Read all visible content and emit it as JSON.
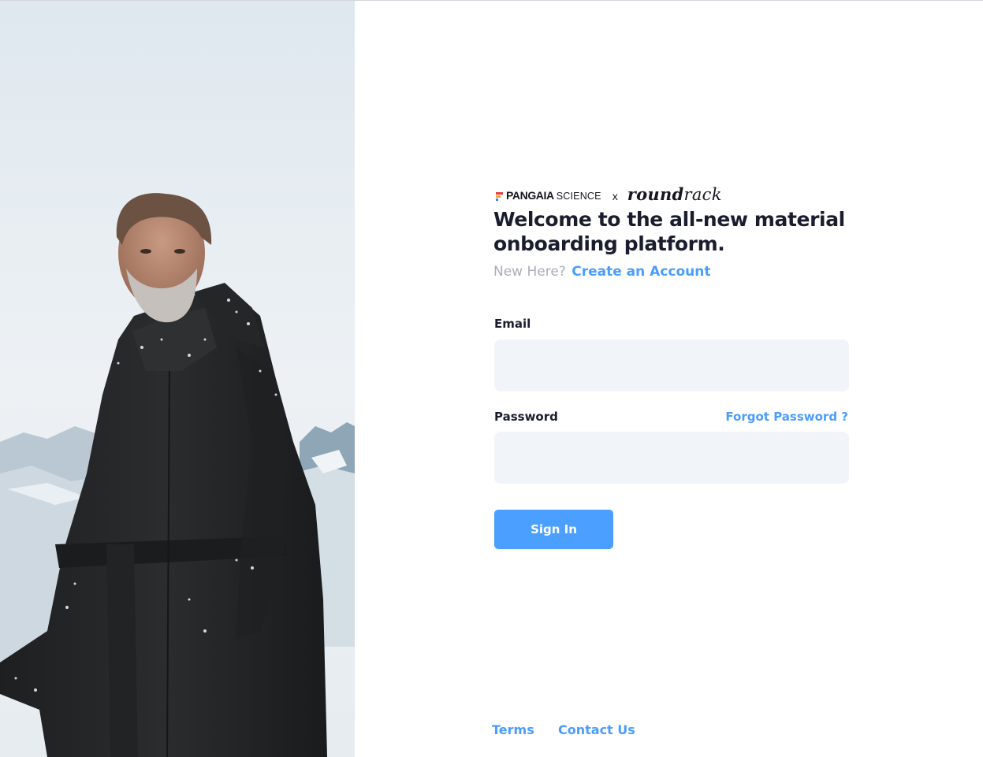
{
  "brand": {
    "partner_name": "PANGAIA",
    "partner_suffix": "SCIENCE",
    "separator": "x",
    "platform_bold": "round",
    "platform_light": "rack",
    "mark_colors": [
      "#e8383d",
      "#f5a623",
      "#3b82f6"
    ]
  },
  "hero": {
    "alt": "Man in a black hooded puffer coat standing in front of snowy mountains"
  },
  "header": {
    "title": "Welcome to the all-new material onboarding platform.",
    "new_here_text": "New Here?",
    "create_account_link": "Create an Account"
  },
  "form": {
    "email_label": "Email",
    "email_value": "",
    "password_label": "Password",
    "password_value": "",
    "forgot_link": "Forgot Password ?",
    "submit_label": "Sign In"
  },
  "footer": {
    "terms_link": "Terms",
    "contact_link": "Contact Us"
  },
  "colors": {
    "accent": "#4a9fff",
    "link": "#4a9dff",
    "input_bg": "#f1f4f9",
    "title": "#1a1d2e",
    "muted": "#a9adb8"
  }
}
